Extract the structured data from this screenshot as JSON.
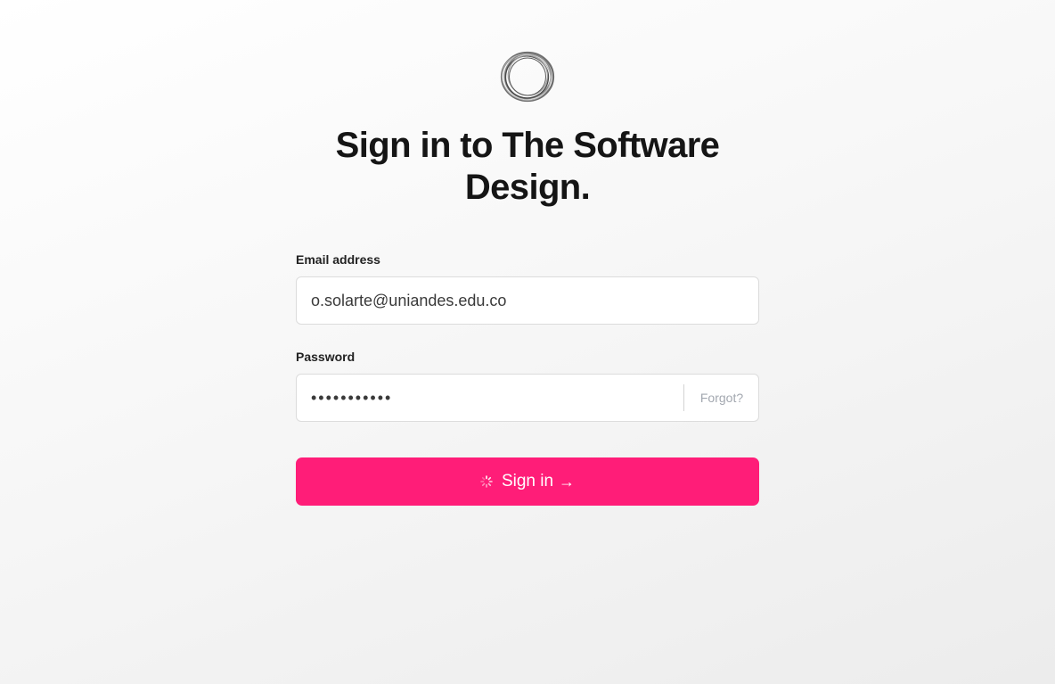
{
  "brand": {
    "logo_icon": "ring-logo-icon"
  },
  "heading": {
    "title": "Sign in to The Software Design."
  },
  "form": {
    "email": {
      "label": "Email address",
      "value": "o.solarte@uniandes.edu.co"
    },
    "password": {
      "label": "Password",
      "masked_value": "•••••••••••",
      "forgot_label": "Forgot?"
    },
    "submit": {
      "label": "Sign in",
      "spinner_icon": "loading-spinner-icon",
      "arrow_icon": "arrow-right-icon",
      "arrow_glyph": "→"
    }
  },
  "colors": {
    "accent": "#ff1d78",
    "link_muted": "#a3a8b0",
    "text": "#151515"
  }
}
